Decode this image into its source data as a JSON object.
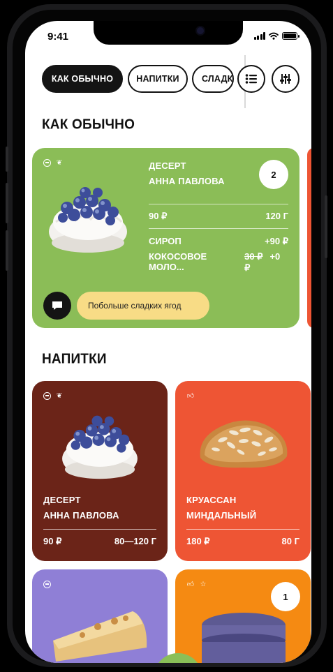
{
  "status_bar": {
    "time": "9:41"
  },
  "tabs": [
    {
      "label": "КАК ОБЫЧНО",
      "active": true
    },
    {
      "label": "НАПИТКИ",
      "active": false
    },
    {
      "label": "СЛАДКОЕ",
      "active": false
    }
  ],
  "toolbar": {
    "list_icon": "list-icon",
    "filter_icon": "filter-sliders-icon"
  },
  "sections": {
    "usual_title": "КАК ОБЫЧНО",
    "drinks_title": "НАПИТКИ"
  },
  "usual_card": {
    "color": "#8bbd57",
    "name_line1": "ДЕСЕРТ",
    "name_line2": "АННА ПАВЛОВА",
    "quantity": "2",
    "price": "90 ₽",
    "weight": "120 Г",
    "syrup_label": "СИРОП",
    "syrup_price": "+90 ₽",
    "milk_label": "КОКОСОВОЕ МОЛО...",
    "milk_old_price": "30 ₽",
    "milk_price": "+0 ₽",
    "comment": "Побольше сладких ягод"
  },
  "drink_cards": [
    {
      "color": "#6b2418",
      "name_line1": "ДЕСЕРТ",
      "name_line2": "АННА ПАВЛОВА",
      "price": "90 ₽",
      "weight": "80—120 Г"
    },
    {
      "color": "#ee5534",
      "name_line1": "КРУАССАН",
      "name_line2": "МИНДАЛЬНЫЙ",
      "price": "180 ₽",
      "weight": "80 Г"
    }
  ],
  "bottom_cards": [
    {
      "color": "#8f7fd6"
    },
    {
      "color": "#f58a12",
      "quantity": "1"
    }
  ],
  "colors": {
    "accent_green": "#8abf58",
    "comment_yellow": "#f8dc86",
    "orange_peek": "#ee5534"
  }
}
